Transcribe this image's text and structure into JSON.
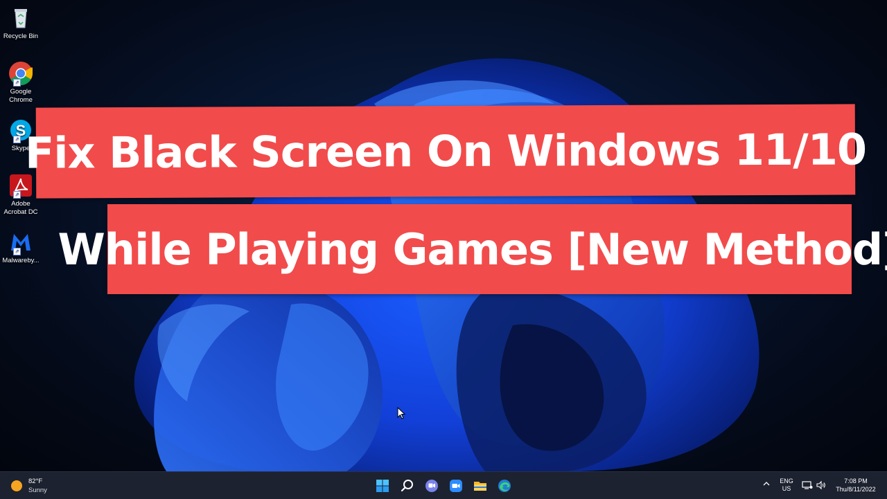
{
  "desktop": {
    "icons": [
      {
        "label": "Recycle Bin",
        "icon": "recycle-bin-icon"
      },
      {
        "label": "Google Chrome",
        "icon": "chrome-icon"
      },
      {
        "label": "Skype",
        "icon": "skype-icon"
      },
      {
        "label": "Adobe Acrobat DC",
        "icon": "acrobat-icon"
      },
      {
        "label": "Malwareby...",
        "icon": "malwarebytes-icon"
      }
    ]
  },
  "banner": {
    "line1": "Fix Black Screen On Windows 11/10",
    "line2": "While Playing Games [New Method]",
    "color": "#f24b4b"
  },
  "taskbar": {
    "weather": {
      "temp": "82°F",
      "condition": "Sunny"
    },
    "apps": [
      "start-icon",
      "search-icon",
      "teams-chat-icon",
      "zoom-icon",
      "file-explorer-icon",
      "edge-icon"
    ],
    "language": {
      "line1": "ENG",
      "line2": "US"
    },
    "time": "7:08 PM",
    "date": "Thu/8/11/2022"
  }
}
